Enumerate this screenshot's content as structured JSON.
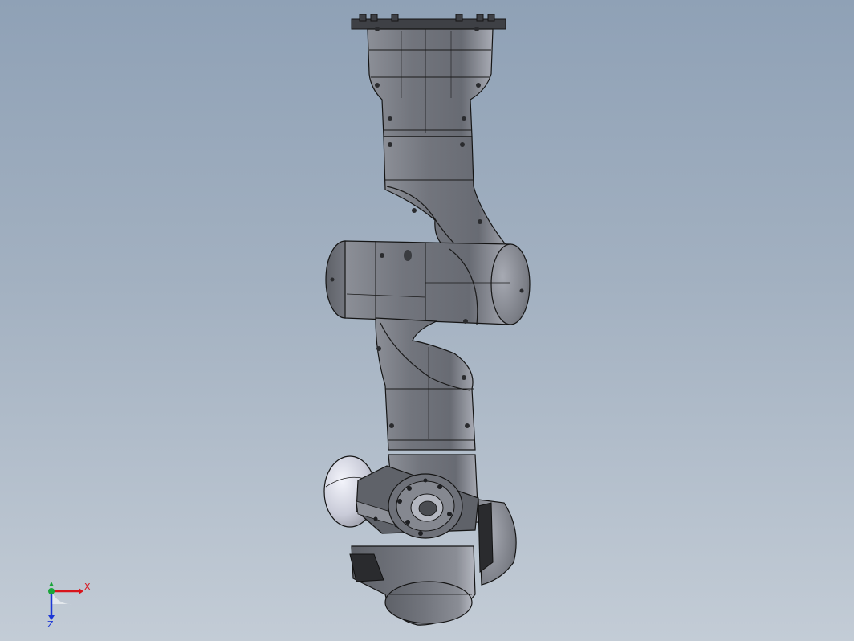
{
  "scene": {
    "model": "robot-arm-6dof",
    "colors": {
      "background_top": "#8fa1b6",
      "background_bottom": "#c3ccd6",
      "body": "#6f727a",
      "body_light": "#9a9da6",
      "body_dark": "#44464c",
      "cap": "#e6e8f2",
      "edge": "#1a1a1a",
      "accent_black": "#2a2b2e"
    }
  },
  "triad": {
    "x_label": "X",
    "z_label": "Z",
    "colors": {
      "x": "#d8141c",
      "y": "#1aa53a",
      "z": "#1b36d6"
    }
  }
}
